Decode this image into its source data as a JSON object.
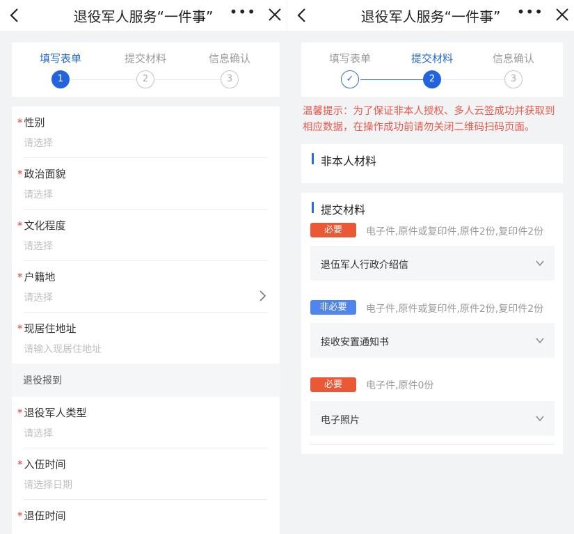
{
  "left": {
    "title": "退役军人服务“一件事”",
    "more": "•••",
    "steps": [
      {
        "label": "填写表单",
        "num": "1",
        "state": "active"
      },
      {
        "label": "提交材料",
        "num": "2",
        "state": "pending"
      },
      {
        "label": "信息确认",
        "num": "3",
        "state": "pending"
      }
    ],
    "required_mark": "*",
    "fields": [
      {
        "label": "性别",
        "placeholder": "请选择"
      },
      {
        "label": "政治面貌",
        "placeholder": "请选择"
      },
      {
        "label": "文化程度",
        "placeholder": "请选择"
      },
      {
        "label": "户籍地",
        "placeholder": "请选择"
      },
      {
        "label": "现居住地址",
        "placeholder": "请输入现居住地址"
      },
      {
        "label": "退役军人类型",
        "placeholder": "请选择"
      },
      {
        "label": "入伍时间",
        "placeholder": "请选择日期"
      },
      {
        "label": "退伍时间",
        "placeholder": ""
      }
    ],
    "section": "退役报到"
  },
  "right": {
    "title": "退役军人服务“一件事”",
    "more": "•••",
    "steps": [
      {
        "label": "填写表单",
        "num": "✓",
        "state": "done"
      },
      {
        "label": "提交材料",
        "num": "2",
        "state": "active"
      },
      {
        "label": "信息确认",
        "num": "3",
        "state": "pending"
      }
    ],
    "tip_line1": "温馨提示：为了保证非本人授权、多人云签成功并获取到",
    "tip_line2": "相应数据，在操作成功前请勿关闭二维码扫码页面。",
    "card1_title": "非本人材料",
    "card2_title": "提交材料",
    "materials": [
      {
        "badge": "必要",
        "badge_type": "required",
        "desc": "电子件,原件或复印件,原件2份,复印件2份",
        "name": "退伍军人行政介绍信"
      },
      {
        "badge": "非必要",
        "badge_type": "optional",
        "desc": "电子件,原件或复印件,原件2份,复印件2份",
        "name": "接收安置通知书"
      },
      {
        "badge": "必要",
        "badge_type": "required",
        "desc": "电子件,原件0份",
        "name": "电子照片"
      }
    ]
  },
  "colors": {
    "accent": "#2264e0",
    "required_badge": "#ea5836",
    "optional_badge": "#4f85ec",
    "tip": "#e85a4a",
    "required_mark": "#e23c3c"
  }
}
